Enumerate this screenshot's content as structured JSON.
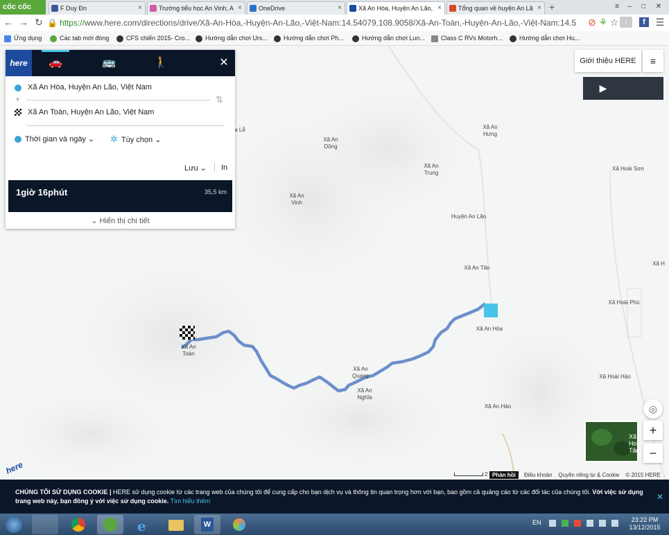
{
  "browser": {
    "logo_label": "cốc cốc",
    "tabs": [
      {
        "title": "F Duy Đn",
        "color": "#3b5998"
      },
      {
        "title": "Trường tiểu học An Vinh, A",
        "color": "#d05ca8"
      },
      {
        "title": "OneDrive",
        "color": "#2a72c8"
      },
      {
        "title": "Xã An Hòa, Huyện An Lão,",
        "color": "#1d4a9c"
      },
      {
        "title": "Tổng quan về huyện An Lã",
        "color": "#d64b2a"
      }
    ],
    "new_tab_label": "+",
    "url_scheme": "https://",
    "url_rest": "www.here.com/directions/drive/Xã-An-Hòa,-Huyện-An-Lão,-Việt-Nam:14.54079,108.9058/Xã-An-Toàn,-Huyện-An-Lão,-Việt-Nam:14.5"
  },
  "bookmarks": [
    "Ứng dụng",
    "Các tab mới đóng",
    "CFS chiến 2015- Cro...",
    "Hướng dẫn chơi Urs...",
    "Hướng dẫn chơi Ph...",
    "Hướng dẫn chơi Lun...",
    "Class C RVs Motorh...",
    "Hướng dẫn chơi Hu..."
  ],
  "panel": {
    "logo": "here",
    "close_label": "✕",
    "origin": "Xã An Hòa, Huyện An Lão, Việt Nam",
    "destination": "Xã An Toàn, Huyện An Lão, Việt Nam",
    "time_option": "Thời gian và ngày",
    "options_label": "Tùy chọn",
    "save_label": "Lưu",
    "print_label": "In",
    "duration": "1giờ 16phút",
    "distance": "35,5 km",
    "show_details": "Hiển thị chi tiết"
  },
  "map": {
    "intro_label": "Giới thiệu HERE",
    "place_labels": [
      "a Lễ",
      "Xã An Dũng",
      "Xã An Hưng",
      "Xã An Trung",
      "Xã Hoài Sơn",
      "Xã An Vinh",
      "Huyện An Lão",
      "Xã An Tân",
      "Xã Hoài Phú",
      "Xã An Hòa",
      "Xã An Toàn",
      "Xã An Quang",
      "Xã An Nghĩa",
      "Xã Hoài Hảo",
      "Xã An Hảo",
      "Xã Hoài Tân",
      "Xã H"
    ],
    "route_color": "#6b8fcb",
    "scale_label": "2 km",
    "feedback_label": "Phản hồi",
    "terms_label": "Điều khoản",
    "privacy_label": "Quyền riêng tư & Cookie",
    "copyright": "© 2015 HERE",
    "zoom_in": "+",
    "zoom_out": "−"
  },
  "cookie": {
    "heading": "CHÚNG TÔI SỬ DỤNG COOKIE |",
    "body": " HERE sử dụng cookie từ các trang web của chúng tôi để cung cấp cho bạn dịch vụ và thông tin quan trọng hơn với bạn, bao gồm cả quảng cáo từ các đối tác của chúng tôi. ",
    "agree": "Với việc sử dụng trang web này, bạn đồng ý với việc sử dụng cookie.",
    "learn_more": "Tìm hiểu thêm",
    "close_label": "✕"
  },
  "taskbar": {
    "lang": "EN",
    "time": "23:22 PM",
    "date": "13/12/2015"
  }
}
